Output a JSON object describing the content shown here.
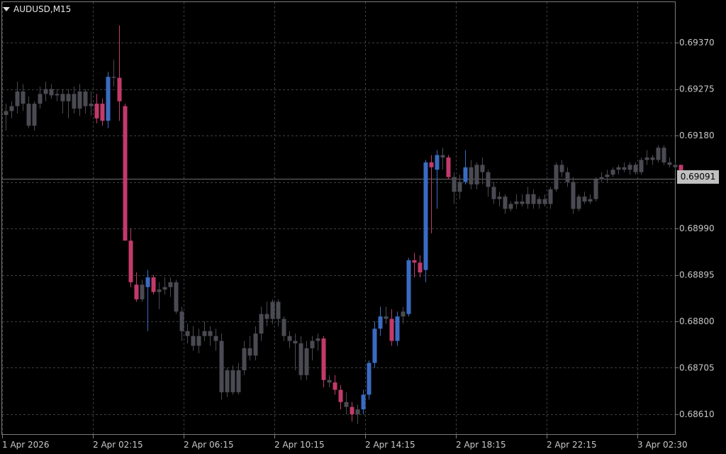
{
  "header": {
    "symbol_label": "AUDUSD,M15"
  },
  "colors": {
    "background": "#000000",
    "grid": "#3a4040",
    "border": "#7a7a7a",
    "neutral_candle": "#4a4a52",
    "bull_candle": "#3a6bc2",
    "bear_candle": "#c23a6a",
    "bid_line": "#6e6e6e",
    "text": "#c8c8c8"
  },
  "price_axis": {
    "ticks": [
      "0.69370",
      "0.69275",
      "0.69180",
      "0.68990",
      "0.68895",
      "0.68800",
      "0.68705",
      "0.68610"
    ],
    "current_price": "0.69091"
  },
  "time_axis": {
    "labels": [
      "1 Apr 2026",
      "2 Apr 02:15",
      "2 Apr 06:15",
      "2 Apr 10:15",
      "2 Apr 14:15",
      "2 Apr 18:15",
      "2 Apr 22:15",
      "3 Apr 02:30"
    ]
  },
  "chart_data": {
    "type": "candlestick",
    "symbol": "AUDUSD",
    "timeframe": "M15",
    "ylim": [
      0.6858,
      0.6944
    ],
    "grid": true,
    "y_ticks": [
      0.6937,
      0.69275,
      0.6918,
      0.69085,
      0.6899,
      0.68895,
      0.688,
      0.68705,
      0.6861
    ],
    "x_labels": [
      "1 Apr 2026",
      "2 Apr 02:15",
      "2 Apr 06:15",
      "2 Apr 10:15",
      "2 Apr 14:15",
      "2 Apr 18:15",
      "2 Apr 22:15",
      "3 Apr 02:30"
    ],
    "current_price": 0.69091,
    "candles": [
      {
        "o": 0.69222,
        "h": 0.69245,
        "l": 0.6919,
        "c": 0.6923,
        "t": "n"
      },
      {
        "o": 0.6923,
        "h": 0.6925,
        "l": 0.69215,
        "c": 0.6924,
        "t": "n"
      },
      {
        "o": 0.6924,
        "h": 0.6929,
        "l": 0.69225,
        "c": 0.6927,
        "t": "n"
      },
      {
        "o": 0.6927,
        "h": 0.69285,
        "l": 0.6923,
        "c": 0.69245,
        "t": "n"
      },
      {
        "o": 0.69245,
        "h": 0.6926,
        "l": 0.69195,
        "c": 0.692,
        "t": "n"
      },
      {
        "o": 0.692,
        "h": 0.6925,
        "l": 0.6919,
        "c": 0.69245,
        "t": "n"
      },
      {
        "o": 0.69245,
        "h": 0.6928,
        "l": 0.69235,
        "c": 0.69265,
        "t": "n"
      },
      {
        "o": 0.69265,
        "h": 0.6929,
        "l": 0.6925,
        "c": 0.69275,
        "t": "n"
      },
      {
        "o": 0.69275,
        "h": 0.69285,
        "l": 0.69255,
        "c": 0.69262,
        "t": "n"
      },
      {
        "o": 0.69262,
        "h": 0.69275,
        "l": 0.6925,
        "c": 0.69265,
        "t": "n"
      },
      {
        "o": 0.69265,
        "h": 0.69275,
        "l": 0.69225,
        "c": 0.6925,
        "t": "n"
      },
      {
        "o": 0.6925,
        "h": 0.69275,
        "l": 0.69215,
        "c": 0.69265,
        "t": "n"
      },
      {
        "o": 0.69265,
        "h": 0.6928,
        "l": 0.69225,
        "c": 0.69235,
        "t": "n"
      },
      {
        "o": 0.69235,
        "h": 0.69285,
        "l": 0.6922,
        "c": 0.6927,
        "t": "n"
      },
      {
        "o": 0.6927,
        "h": 0.69275,
        "l": 0.69225,
        "c": 0.6924,
        "t": "n"
      },
      {
        "o": 0.6924,
        "h": 0.6927,
        "l": 0.6922,
        "c": 0.69245,
        "t": "n"
      },
      {
        "o": 0.69245,
        "h": 0.69265,
        "l": 0.69205,
        "c": 0.69215,
        "t": "b"
      },
      {
        "o": 0.69245,
        "h": 0.69255,
        "l": 0.692,
        "c": 0.6921,
        "t": "b"
      },
      {
        "o": 0.6921,
        "h": 0.6931,
        "l": 0.69195,
        "c": 0.693,
        "t": "u"
      },
      {
        "o": 0.693,
        "h": 0.69335,
        "l": 0.6928,
        "c": 0.69298,
        "t": "n"
      },
      {
        "o": 0.69298,
        "h": 0.69405,
        "l": 0.6921,
        "c": 0.6925,
        "t": "b"
      },
      {
        "o": 0.6924,
        "h": 0.69245,
        "l": 0.6897,
        "c": 0.68965,
        "t": "b"
      },
      {
        "o": 0.68965,
        "h": 0.6899,
        "l": 0.6887,
        "c": 0.6888,
        "t": "b"
      },
      {
        "o": 0.68875,
        "h": 0.689,
        "l": 0.6884,
        "c": 0.68845,
        "t": "b"
      },
      {
        "o": 0.68845,
        "h": 0.68885,
        "l": 0.6884,
        "c": 0.68875,
        "t": "n"
      },
      {
        "o": 0.6887,
        "h": 0.68905,
        "l": 0.6878,
        "c": 0.6889,
        "t": "u"
      },
      {
        "o": 0.6889,
        "h": 0.68895,
        "l": 0.68855,
        "c": 0.6886,
        "t": "b"
      },
      {
        "o": 0.6886,
        "h": 0.6888,
        "l": 0.68825,
        "c": 0.68865,
        "t": "n"
      },
      {
        "o": 0.68865,
        "h": 0.6889,
        "l": 0.68855,
        "c": 0.6887,
        "t": "n"
      },
      {
        "o": 0.6887,
        "h": 0.6889,
        "l": 0.6885,
        "c": 0.6888,
        "t": "n"
      },
      {
        "o": 0.6888,
        "h": 0.68885,
        "l": 0.68815,
        "c": 0.6882,
        "t": "n"
      },
      {
        "o": 0.6882,
        "h": 0.6883,
        "l": 0.6876,
        "c": 0.6878,
        "t": "n"
      },
      {
        "o": 0.6878,
        "h": 0.68795,
        "l": 0.68755,
        "c": 0.6877,
        "t": "n"
      },
      {
        "o": 0.6877,
        "h": 0.6879,
        "l": 0.6874,
        "c": 0.6875,
        "t": "n"
      },
      {
        "o": 0.6875,
        "h": 0.68785,
        "l": 0.68735,
        "c": 0.6877,
        "t": "n"
      },
      {
        "o": 0.6877,
        "h": 0.688,
        "l": 0.6876,
        "c": 0.6878,
        "t": "n"
      },
      {
        "o": 0.6878,
        "h": 0.6879,
        "l": 0.6875,
        "c": 0.6877,
        "t": "n"
      },
      {
        "o": 0.6877,
        "h": 0.68785,
        "l": 0.6874,
        "c": 0.6876,
        "t": "n"
      },
      {
        "o": 0.6876,
        "h": 0.68775,
        "l": 0.6864,
        "c": 0.68655,
        "t": "n"
      },
      {
        "o": 0.68655,
        "h": 0.68705,
        "l": 0.68645,
        "c": 0.687,
        "t": "n"
      },
      {
        "o": 0.687,
        "h": 0.6871,
        "l": 0.6865,
        "c": 0.68655,
        "t": "n"
      },
      {
        "o": 0.68655,
        "h": 0.68715,
        "l": 0.6865,
        "c": 0.687,
        "t": "n"
      },
      {
        "o": 0.687,
        "h": 0.6876,
        "l": 0.6869,
        "c": 0.68745,
        "t": "n"
      },
      {
        "o": 0.68745,
        "h": 0.6877,
        "l": 0.6872,
        "c": 0.6873,
        "t": "n"
      },
      {
        "o": 0.6873,
        "h": 0.6879,
        "l": 0.6872,
        "c": 0.68775,
        "t": "n"
      },
      {
        "o": 0.68775,
        "h": 0.6883,
        "l": 0.6876,
        "c": 0.68815,
        "t": "n"
      },
      {
        "o": 0.68815,
        "h": 0.6884,
        "l": 0.6879,
        "c": 0.68805,
        "t": "n"
      },
      {
        "o": 0.68805,
        "h": 0.68845,
        "l": 0.68795,
        "c": 0.6884,
        "t": "n"
      },
      {
        "o": 0.6884,
        "h": 0.68845,
        "l": 0.6879,
        "c": 0.68805,
        "t": "n"
      },
      {
        "o": 0.68805,
        "h": 0.6881,
        "l": 0.6876,
        "c": 0.6877,
        "t": "n"
      },
      {
        "o": 0.6877,
        "h": 0.6878,
        "l": 0.68745,
        "c": 0.6876,
        "t": "n"
      },
      {
        "o": 0.6876,
        "h": 0.68775,
        "l": 0.687,
        "c": 0.68755,
        "t": "n"
      },
      {
        "o": 0.68755,
        "h": 0.6877,
        "l": 0.6868,
        "c": 0.6869,
        "t": "n"
      },
      {
        "o": 0.6869,
        "h": 0.6876,
        "l": 0.6868,
        "c": 0.68745,
        "t": "n"
      },
      {
        "o": 0.68745,
        "h": 0.6877,
        "l": 0.6872,
        "c": 0.6876,
        "t": "n"
      },
      {
        "o": 0.6876,
        "h": 0.68775,
        "l": 0.6874,
        "c": 0.68765,
        "t": "n"
      },
      {
        "o": 0.68765,
        "h": 0.6877,
        "l": 0.68665,
        "c": 0.6868,
        "t": "b"
      },
      {
        "o": 0.6868,
        "h": 0.6869,
        "l": 0.68665,
        "c": 0.68675,
        "t": "n"
      },
      {
        "o": 0.68675,
        "h": 0.6869,
        "l": 0.6865,
        "c": 0.6866,
        "t": "b"
      },
      {
        "o": 0.6866,
        "h": 0.6867,
        "l": 0.6862,
        "c": 0.68635,
        "t": "b"
      },
      {
        "o": 0.68635,
        "h": 0.68655,
        "l": 0.6861,
        "c": 0.68625,
        "t": "n"
      },
      {
        "o": 0.68625,
        "h": 0.68635,
        "l": 0.68595,
        "c": 0.6861,
        "t": "b"
      },
      {
        "o": 0.6861,
        "h": 0.6863,
        "l": 0.6859,
        "c": 0.6862,
        "t": "n"
      },
      {
        "o": 0.6862,
        "h": 0.6866,
        "l": 0.6861,
        "c": 0.6865,
        "t": "u"
      },
      {
        "o": 0.6865,
        "h": 0.6872,
        "l": 0.6864,
        "c": 0.68715,
        "t": "u"
      },
      {
        "o": 0.68715,
        "h": 0.688,
        "l": 0.68705,
        "c": 0.68785,
        "t": "u"
      },
      {
        "o": 0.68785,
        "h": 0.6883,
        "l": 0.6877,
        "c": 0.6881,
        "t": "u"
      },
      {
        "o": 0.6881,
        "h": 0.6883,
        "l": 0.68795,
        "c": 0.68805,
        "t": "n"
      },
      {
        "o": 0.68805,
        "h": 0.68825,
        "l": 0.6875,
        "c": 0.6876,
        "t": "b"
      },
      {
        "o": 0.6876,
        "h": 0.6882,
        "l": 0.6875,
        "c": 0.6881,
        "t": "u"
      },
      {
        "o": 0.6881,
        "h": 0.6883,
        "l": 0.68795,
        "c": 0.6882,
        "t": "n"
      },
      {
        "o": 0.68815,
        "h": 0.6893,
        "l": 0.6881,
        "c": 0.68925,
        "t": "u"
      },
      {
        "o": 0.68925,
        "h": 0.6894,
        "l": 0.6889,
        "c": 0.6892,
        "t": "b"
      },
      {
        "o": 0.6892,
        "h": 0.68935,
        "l": 0.6889,
        "c": 0.689,
        "t": "b"
      },
      {
        "o": 0.68905,
        "h": 0.6913,
        "l": 0.6888,
        "c": 0.69125,
        "t": "u"
      },
      {
        "o": 0.69125,
        "h": 0.6914,
        "l": 0.6898,
        "c": 0.69115,
        "t": "b"
      },
      {
        "o": 0.6911,
        "h": 0.6915,
        "l": 0.6903,
        "c": 0.6914,
        "t": "u"
      },
      {
        "o": 0.6914,
        "h": 0.69155,
        "l": 0.6911,
        "c": 0.69135,
        "t": "n"
      },
      {
        "o": 0.69135,
        "h": 0.6914,
        "l": 0.6909,
        "c": 0.69095,
        "t": "b"
      },
      {
        "o": 0.69095,
        "h": 0.69105,
        "l": 0.6904,
        "c": 0.69065,
        "t": "n"
      },
      {
        "o": 0.69065,
        "h": 0.691,
        "l": 0.6905,
        "c": 0.69085,
        "t": "n"
      },
      {
        "o": 0.69085,
        "h": 0.6915,
        "l": 0.6908,
        "c": 0.69115,
        "t": "u"
      },
      {
        "o": 0.69115,
        "h": 0.6913,
        "l": 0.6907,
        "c": 0.6908,
        "t": "n"
      },
      {
        "o": 0.6908,
        "h": 0.69125,
        "l": 0.6907,
        "c": 0.6912,
        "t": "n"
      },
      {
        "o": 0.6912,
        "h": 0.69135,
        "l": 0.6908,
        "c": 0.69105,
        "t": "n"
      },
      {
        "o": 0.69105,
        "h": 0.6911,
        "l": 0.69055,
        "c": 0.69075,
        "t": "n"
      },
      {
        "o": 0.69075,
        "h": 0.69085,
        "l": 0.6904,
        "c": 0.6905,
        "t": "n"
      },
      {
        "o": 0.6905,
        "h": 0.69065,
        "l": 0.69035,
        "c": 0.69055,
        "t": "n"
      },
      {
        "o": 0.69055,
        "h": 0.6906,
        "l": 0.6902,
        "c": 0.6903,
        "t": "n"
      },
      {
        "o": 0.6903,
        "h": 0.69045,
        "l": 0.69025,
        "c": 0.6904,
        "t": "n"
      },
      {
        "o": 0.6904,
        "h": 0.6906,
        "l": 0.6903,
        "c": 0.69045,
        "t": "n"
      },
      {
        "o": 0.69045,
        "h": 0.6906,
        "l": 0.69035,
        "c": 0.6904,
        "t": "n"
      },
      {
        "o": 0.6904,
        "h": 0.69075,
        "l": 0.6903,
        "c": 0.6906,
        "t": "n"
      },
      {
        "o": 0.6906,
        "h": 0.6907,
        "l": 0.6903,
        "c": 0.6904,
        "t": "n"
      },
      {
        "o": 0.6904,
        "h": 0.69055,
        "l": 0.6903,
        "c": 0.6905,
        "t": "n"
      },
      {
        "o": 0.6905,
        "h": 0.6906,
        "l": 0.69035,
        "c": 0.6904,
        "t": "n"
      },
      {
        "o": 0.6904,
        "h": 0.69075,
        "l": 0.6903,
        "c": 0.6907,
        "t": "n"
      },
      {
        "o": 0.6907,
        "h": 0.69125,
        "l": 0.69065,
        "c": 0.6912,
        "t": "n"
      },
      {
        "o": 0.6912,
        "h": 0.6913,
        "l": 0.69095,
        "c": 0.69105,
        "t": "n"
      },
      {
        "o": 0.69105,
        "h": 0.69115,
        "l": 0.69075,
        "c": 0.69085,
        "t": "n"
      },
      {
        "o": 0.69085,
        "h": 0.69095,
        "l": 0.6902,
        "c": 0.6903,
        "t": "n"
      },
      {
        "o": 0.6903,
        "h": 0.6906,
        "l": 0.69025,
        "c": 0.69055,
        "t": "n"
      },
      {
        "o": 0.69055,
        "h": 0.69065,
        "l": 0.6904,
        "c": 0.69045,
        "t": "n"
      },
      {
        "o": 0.69045,
        "h": 0.6906,
        "l": 0.6904,
        "c": 0.6905,
        "t": "n"
      },
      {
        "o": 0.6905,
        "h": 0.69095,
        "l": 0.69045,
        "c": 0.6909,
        "t": "n"
      },
      {
        "o": 0.6909,
        "h": 0.69105,
        "l": 0.69085,
        "c": 0.69095,
        "t": "n"
      },
      {
        "o": 0.69095,
        "h": 0.6911,
        "l": 0.69085,
        "c": 0.691,
        "t": "n"
      },
      {
        "o": 0.691,
        "h": 0.69115,
        "l": 0.69095,
        "c": 0.6911,
        "t": "n"
      },
      {
        "o": 0.6911,
        "h": 0.6912,
        "l": 0.691,
        "c": 0.69115,
        "t": "n"
      },
      {
        "o": 0.69115,
        "h": 0.69125,
        "l": 0.69105,
        "c": 0.6911,
        "t": "n"
      },
      {
        "o": 0.6911,
        "h": 0.69125,
        "l": 0.691,
        "c": 0.6912,
        "t": "n"
      },
      {
        "o": 0.6912,
        "h": 0.69125,
        "l": 0.691,
        "c": 0.69105,
        "t": "n"
      },
      {
        "o": 0.69105,
        "h": 0.69135,
        "l": 0.691,
        "c": 0.6913,
        "t": "n"
      },
      {
        "o": 0.6913,
        "h": 0.6915,
        "l": 0.6912,
        "c": 0.69135,
        "t": "n"
      },
      {
        "o": 0.69135,
        "h": 0.6914,
        "l": 0.6912,
        "c": 0.6913,
        "t": "n"
      },
      {
        "o": 0.6913,
        "h": 0.6916,
        "l": 0.69125,
        "c": 0.69155,
        "t": "n"
      },
      {
        "o": 0.69155,
        "h": 0.6916,
        "l": 0.6912,
        "c": 0.69125,
        "t": "n"
      },
      {
        "o": 0.69125,
        "h": 0.69135,
        "l": 0.69115,
        "c": 0.6912,
        "t": "n"
      },
      {
        "o": 0.6912,
        "h": 0.69125,
        "l": 0.6911,
        "c": 0.69115,
        "t": "n"
      },
      {
        "o": 0.6912,
        "h": 0.6912,
        "l": 0.69088,
        "c": 0.69091,
        "t": "b"
      }
    ]
  }
}
